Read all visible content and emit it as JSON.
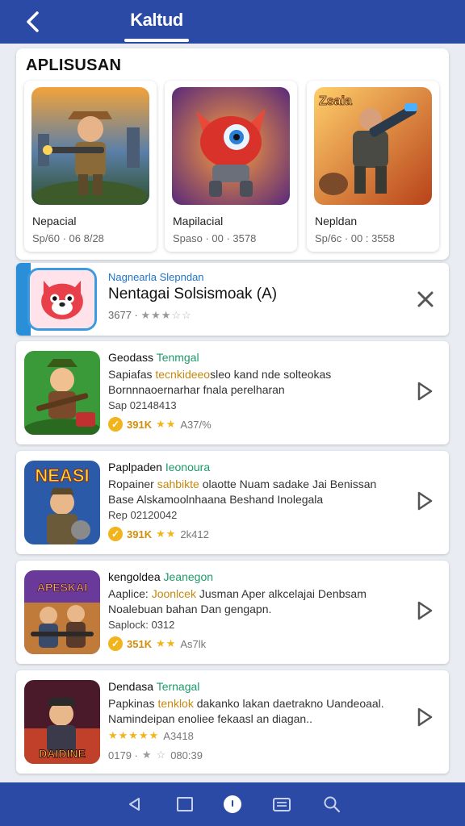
{
  "header": {
    "title": "Kaltud",
    "back_icon": "back-chevron-icon"
  },
  "section": {
    "title": "APLISUSAN"
  },
  "featured": [
    {
      "name": "Nepacial",
      "meta": "Sp/60 · 06 8/28",
      "art": "soldier-hero"
    },
    {
      "name": "Mapilacial",
      "meta": "Spaso · 00 · 3578",
      "art": "red-robot"
    },
    {
      "name": "Nepldan",
      "meta": "Sp/6c · 00 : 3558",
      "art": "armored-gunner",
      "art_label": "Zsaia"
    }
  ],
  "promo": {
    "sponsor": "Nagnearla Slepndan",
    "headline": "Nentagai Solsismoak (A)",
    "meta": "3677 ·",
    "stars_filled": "★★★",
    "stars_empty": "☆☆",
    "close_icon": "close-x-icon"
  },
  "apps": [
    {
      "title": "Geodass",
      "tag": "Tenmgal",
      "desc_line1_pre": "Sapiafas ",
      "desc_line1_hl": "tecnkideeo",
      "desc_line1_post": "sleo kand nde solteokas",
      "desc_line2": "Bornnnaoernarhar fnala perelharan",
      "sub": "Sap  02148413",
      "badge": "✓",
      "score": "391K",
      "stars": "★★",
      "count": "A37/%"
    },
    {
      "title": "Paplpaden",
      "tag": "Ieonoura",
      "desc_line1_pre": "Ropainer ",
      "desc_line1_hl": "sahbikte",
      "desc_line1_post": " olaotte Nuam sadake Jai Benissan",
      "desc_line2": "Base Alskamoolnhaana Beshand Inolegala",
      "sub": "Rep  02120042",
      "badge": "✓",
      "score": "391K",
      "stars": "★★",
      "count": "2k412",
      "icon_label": "NEASI"
    },
    {
      "title": "kengoldea",
      "tag": "Jeanegon",
      "desc_line1_pre": "Aaplice: ",
      "desc_line1_hl": "Joonlcek",
      "desc_line1_post": " Jusman Aper alkcelajai Denbsam",
      "desc_line2": "Noalebuan bahan Dan gengapn.",
      "sub": "Saplock: 0312",
      "badge": "✓",
      "score": "351K",
      "stars": "★★",
      "count": "As7lk",
      "icon_label": "APESKAI"
    },
    {
      "title": "Dendasa",
      "tag": "Ternagal",
      "desc_line1_pre": "Papkinas ",
      "desc_line1_hl": "tenklok",
      "desc_line1_post": " dakanko lakan daetrakno Uandeoaal.",
      "desc_line2": "Namindeipan enoliee fekaasl an diagan..",
      "sub": "",
      "stars": "★★★★★",
      "count": "A3418",
      "meta": "0179 ·",
      "stars_filled2": "★",
      "stars_empty2": "☆",
      "count2": "080:39",
      "icon_label": "DAIDINE"
    }
  ],
  "navbar": {
    "icons": [
      "back-triangle-icon",
      "recent-square-icon",
      "home-dot-icon",
      "apps-grid-icon",
      "search-icon"
    ]
  },
  "colors": {
    "primary": "#2b4aa6",
    "accent_blue": "#2a8fd8",
    "star": "#f2b41c",
    "tag_green": "#1c9b6a"
  }
}
